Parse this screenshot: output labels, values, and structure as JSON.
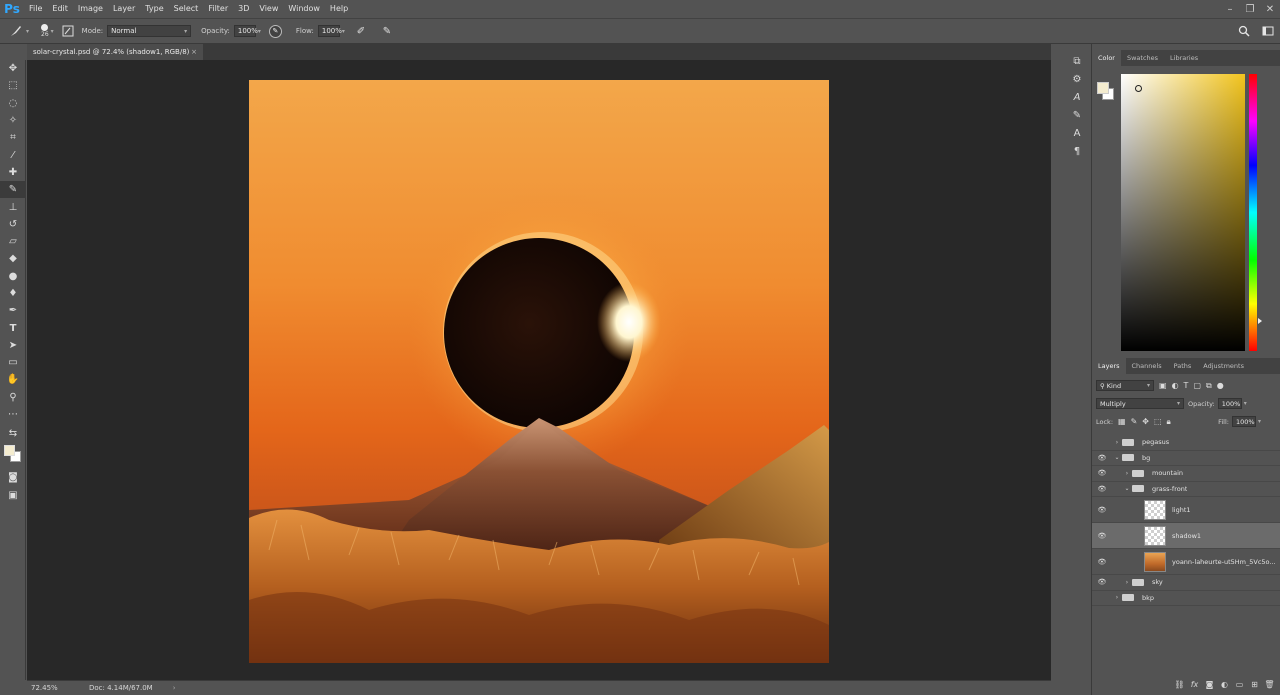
{
  "menubar": {
    "logo": "Ps",
    "items": [
      "File",
      "Edit",
      "Image",
      "Layer",
      "Type",
      "Select",
      "Filter",
      "3D",
      "View",
      "Window",
      "Help"
    ],
    "controls": [
      "–",
      "❐",
      "✕"
    ]
  },
  "options": {
    "brush_size": "26",
    "mode_label": "Mode:",
    "mode_value": "Normal",
    "opacity_label": "Opacity:",
    "opacity_value": "100%",
    "flow_label": "Flow:",
    "flow_value": "100%"
  },
  "document": {
    "tab_title": "solar-crystal.psd @ 72.4% (shadow1, RGB/8)",
    "tab_close": "×"
  },
  "status": {
    "zoom": "72.45%",
    "doc_size": "Doc: 4.14M/67.0M"
  },
  "color_panel": {
    "tabs": [
      "Color",
      "Swatches",
      "Libraries"
    ],
    "foreground": "#f4eccf",
    "background": "#ffffff",
    "hue_base": "#f2c41d"
  },
  "layers_panel": {
    "tabs": [
      "Layers",
      "Channels",
      "Paths",
      "Adjustments"
    ],
    "kind_label": "Kind",
    "blend_mode": "Multiply",
    "opacity_label": "Opacity:",
    "opacity_value": "100%",
    "lock_label": "Lock:",
    "fill_label": "Fill:",
    "fill_value": "100%",
    "layers": [
      {
        "name": "pegasus",
        "type": "group",
        "visible": false,
        "indent": 0,
        "expanded": false
      },
      {
        "name": "bg",
        "type": "group",
        "visible": true,
        "indent": 0,
        "expanded": true
      },
      {
        "name": "mountain",
        "type": "group",
        "visible": true,
        "indent": 1,
        "expanded": false
      },
      {
        "name": "grass-front",
        "type": "group",
        "visible": true,
        "indent": 1,
        "expanded": true
      },
      {
        "name": "light1",
        "type": "layer",
        "visible": true,
        "indent": 2,
        "selected": false,
        "photo": false
      },
      {
        "name": "shadow1",
        "type": "layer",
        "visible": true,
        "indent": 2,
        "selected": true,
        "photo": false
      },
      {
        "name": "yoann-laheurte-ut5Hm_5Vc5o...",
        "type": "layer",
        "visible": true,
        "indent": 2,
        "selected": false,
        "photo": true
      },
      {
        "name": "sky",
        "type": "group",
        "visible": true,
        "indent": 1,
        "expanded": false
      },
      {
        "name": "bkp",
        "type": "group",
        "visible": false,
        "indent": 0,
        "expanded": false
      }
    ]
  }
}
